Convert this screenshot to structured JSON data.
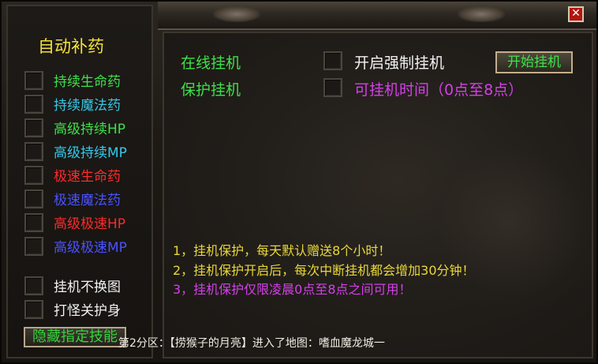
{
  "left": {
    "title": "自动补药",
    "options": [
      {
        "label": "持续生命药",
        "color": "#3ee14a"
      },
      {
        "label": "持续魔法药",
        "color": "#35c8e8"
      },
      {
        "label": "高级持续HP",
        "color": "#3ee14a"
      },
      {
        "label": "高级持续MP",
        "color": "#35c8e8"
      },
      {
        "label": "极速生命药",
        "color": "#ff2a2a"
      },
      {
        "label": "极速魔法药",
        "color": "#4a52ff"
      },
      {
        "label": "高级极速HP",
        "color": "#ff2a2a"
      },
      {
        "label": "高级极速MP",
        "color": "#4a52ff"
      }
    ],
    "extras": [
      {
        "label": "挂机不换图",
        "color": "#f2f2f2"
      },
      {
        "label": "打怪关护身",
        "color": "#f2f2f2"
      }
    ],
    "hide_skills_button": "隐藏指定技能"
  },
  "main": {
    "online_hangup": "在线挂机",
    "protect_hangup": "保护挂机",
    "force_hangup_label": "开启强制挂机",
    "hangup_time_label": "可挂机时间（0点至8点）",
    "start_button": "开始挂机",
    "notes": [
      {
        "text": "1，挂机保护，每天默认赠送8个小时！",
        "color": "#e8d83a"
      },
      {
        "text": "2，挂机保护开启后，每次中断挂机都会增加30分钟！",
        "color": "#e8d83a"
      },
      {
        "text": "3，挂机保护仅限凌晨0点至8点之间可用！",
        "color": "#d440e8"
      }
    ]
  },
  "system_message": "第2分区：【捞猴子的月亮】进入了地图：嗜血魔龙城一",
  "close_icon": "close-icon",
  "colors": {
    "green": "#3ee14a",
    "magenta": "#d440e8",
    "yellow": "#e8d83a",
    "close_red": "#b0170e"
  }
}
